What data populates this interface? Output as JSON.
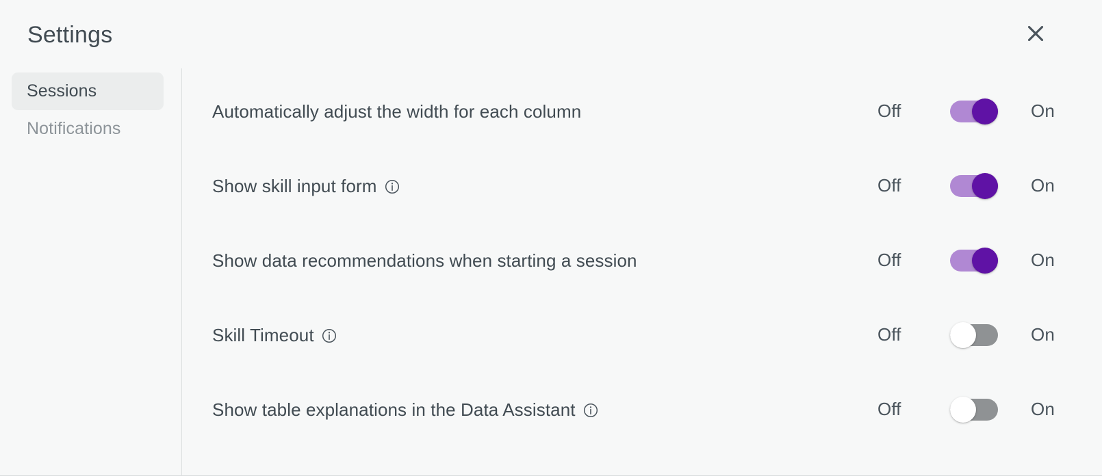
{
  "dialog": {
    "title": "Settings",
    "close_icon": "close-icon",
    "close_label": "Close"
  },
  "sidebar": {
    "items": [
      {
        "label": "Sessions",
        "selected": true
      },
      {
        "label": "Notifications",
        "selected": false
      }
    ]
  },
  "toggle_labels": {
    "off": "Off",
    "on": "On"
  },
  "colors": {
    "page_background": "#f7f8f8",
    "text_primary": "#414b52",
    "text_muted": "#8d9499",
    "sidebar_selected_background": "#ebeded",
    "divider": "#dcdfe0",
    "toggle_on_track": "#b088d3",
    "toggle_on_knob": "#5f12a5",
    "toggle_off_track": "#8f9294",
    "toggle_off_knob": "#ffffff"
  },
  "settings": [
    {
      "label": "Automatically adjust the width for each column",
      "has_info_icon": false,
      "state": "on"
    },
    {
      "label": "Show skill input form",
      "has_info_icon": true,
      "state": "on"
    },
    {
      "label": "Show data recommendations when starting a session",
      "has_info_icon": false,
      "state": "on"
    },
    {
      "label": "Skill Timeout",
      "has_info_icon": true,
      "state": "off"
    },
    {
      "label": "Show table explanations in the Data Assistant",
      "has_info_icon": true,
      "state": "off"
    }
  ]
}
